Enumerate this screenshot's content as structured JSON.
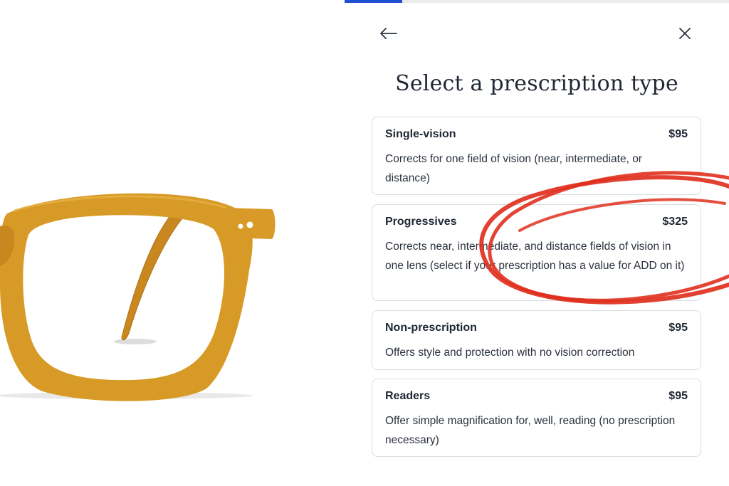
{
  "header": {
    "title": "Select a prescription type",
    "back_icon": "arrow-left-icon",
    "close_icon": "close-icon"
  },
  "progress": {
    "fraction": 0.15
  },
  "product": {
    "image": "eyeglasses-frame",
    "frame_color": "#d79a26"
  },
  "options": [
    {
      "name": "Single-vision",
      "price": "$95",
      "description": "Corrects for one field of vision (near, intermediate, or distance)"
    },
    {
      "name": "Progressives",
      "price": "$325",
      "description": "Corrects near, intermediate, and distance fields of vision in one lens (select if your prescription has a value for ADD on it)"
    },
    {
      "name": "Non-prescription",
      "price": "$95",
      "description": "Offers style and protection with no vision correction"
    },
    {
      "name": "Readers",
      "price": "$95",
      "description": "Offer simple magnification for, well, reading (no prescription necessary)"
    }
  ],
  "colors": {
    "accent": "#1e4fd0",
    "annotation": "#e0301e",
    "text": "#1f2733",
    "border": "#d9dde3"
  }
}
